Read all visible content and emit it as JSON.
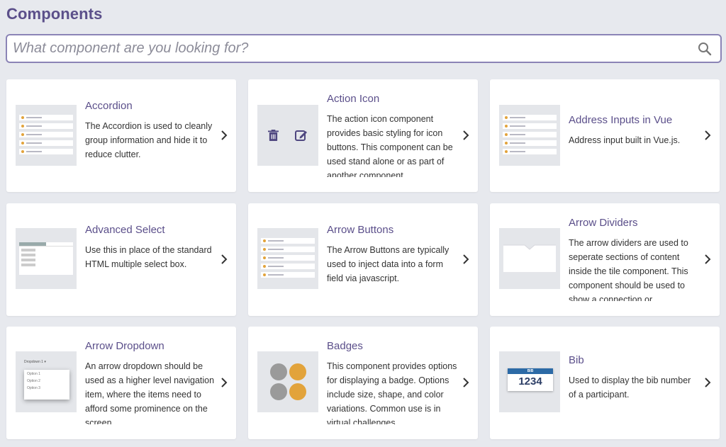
{
  "header": {
    "title": "Components"
  },
  "search": {
    "placeholder": "What component are you looking for?"
  },
  "cards": [
    {
      "title": "Accordion",
      "desc": "The Accordion is used to cleanly group information and hide it to reduce clutter."
    },
    {
      "title": "Action Icon",
      "desc": "The action icon component provides basic styling for icon buttons. This component can be used stand alone or as part of another component."
    },
    {
      "title": "Address Inputs in Vue",
      "desc": "Address input built in Vue.js."
    },
    {
      "title": "Advanced Select",
      "desc": "Use this in place of the standard HTML multiple select box."
    },
    {
      "title": "Arrow Buttons",
      "desc": "The Arrow Buttons are typically used to inject data into a form field via javascript."
    },
    {
      "title": "Arrow Dividers",
      "desc": "The arrow dividers are used to seperate sections of content inside the tile component. This component should be used to show a connection or"
    },
    {
      "title": "Arrow Dropdown",
      "desc": "An arrow dropdown should be used as a higher level navigation item, where the items need to afford some prominence on the screen"
    },
    {
      "title": "Badges",
      "desc": "This component provides options for displaying a badge. Options include size, shape, and color variations. Common use is in virtual challenges"
    },
    {
      "title": "Bib",
      "desc": "Used to display the bib number of a participant."
    }
  ],
  "thumbs": {
    "dropdown_label": "Dropdown 1 ▾",
    "dropdown_options": [
      "Option 1",
      "Option 2",
      "Option 3"
    ],
    "bib_header": "BIB",
    "bib_number": "1234"
  },
  "colors": {
    "accent": "#5b4f8a",
    "search_border": "#8b84b6",
    "background": "#e7e9ee"
  }
}
